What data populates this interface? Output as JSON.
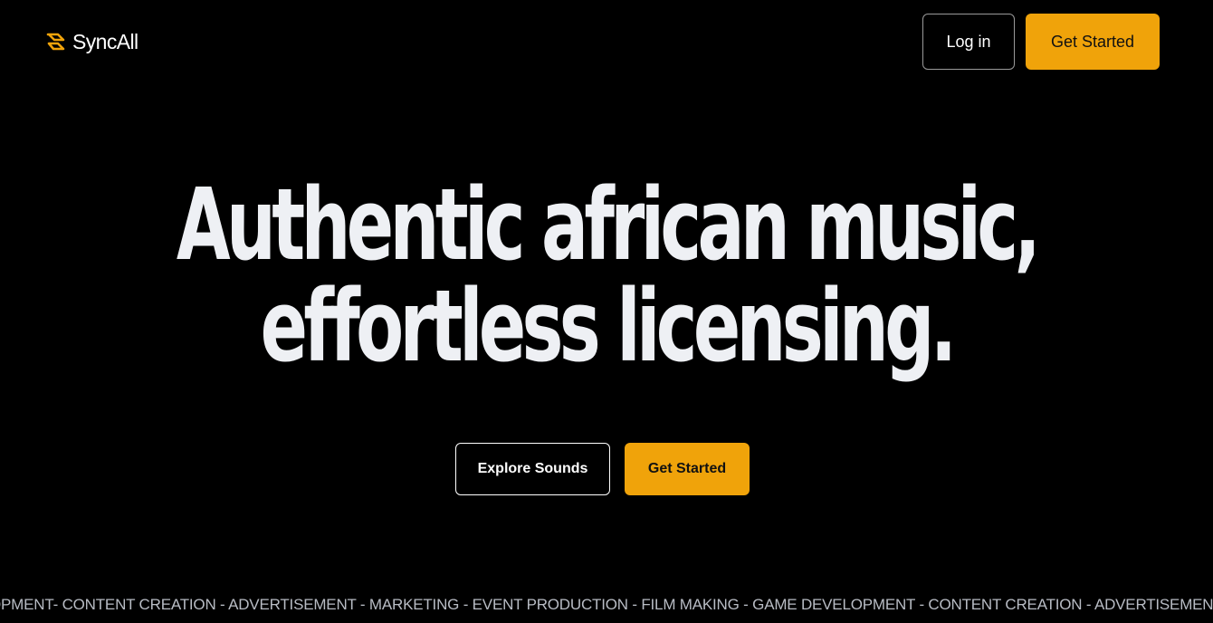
{
  "brand": {
    "name": "SyncAll",
    "icon": "syncall-logo-icon",
    "accent_color": "#f0a30a"
  },
  "header": {
    "login_label": "Log in",
    "get_started_label": "Get Started"
  },
  "hero": {
    "line1": "Authentic african music,",
    "line2": "effortless licensing.",
    "explore_label": "Explore Sounds",
    "get_started_label": "Get Started"
  },
  "ticker": {
    "text": "OPMENT- CONTENT CREATION - ADVERTISEMENT - MARKETING - EVENT PRODUCTION - FILM MAKING - GAME DEVELOPMENT - CONTENT CREATION - ADVERTISEMENT - MA"
  }
}
